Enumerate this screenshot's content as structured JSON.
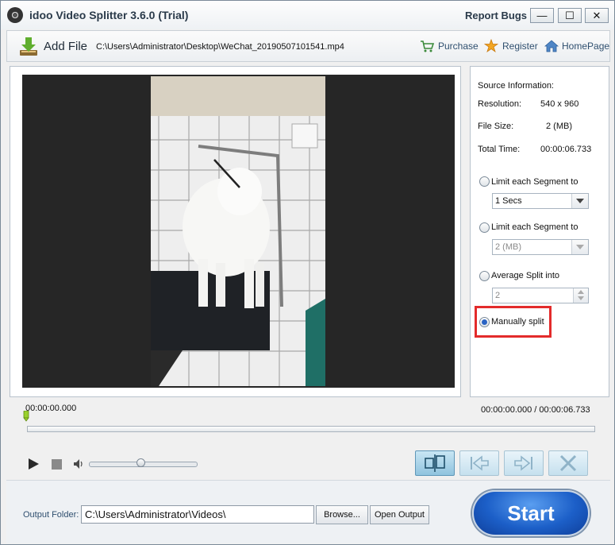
{
  "window": {
    "title": "idoo Video Splitter 3.6.0 (Trial)",
    "report_bugs": "Report Bugs",
    "minimize": "—",
    "maximize": "☐",
    "close": "✕"
  },
  "toolbar": {
    "add_file": "Add File",
    "file_path": "C:\\Users\\Administrator\\Desktop\\WeChat_20190507101541.mp4",
    "purchase": "Purchase",
    "register": "Register",
    "homepage": "HomePage"
  },
  "source_info": {
    "heading": "Source Information:",
    "resolution_label": "Resolution:",
    "resolution_value": "540 x 960",
    "filesize_label": "File Size:",
    "filesize_value": "2 (MB)",
    "totaltime_label": "Total Time:",
    "totaltime_value": "00:00:06.733"
  },
  "split_options": {
    "limit_time_label": "Limit each Segment to",
    "limit_time_value": "1 Secs",
    "limit_size_label": "Limit each Segment to",
    "limit_size_value": "2 (MB)",
    "average_label": "Average Split into",
    "average_value": "2",
    "manual_label": "Manually split",
    "selected": "manual"
  },
  "timeline": {
    "current_marker": "00:00:00.000",
    "position_display": "00:00:00.000 / 00:00:06.733",
    "playhead_fraction": 0,
    "volume_fraction": 0.48
  },
  "output": {
    "label": "Output Folder:",
    "path": "C:\\Users\\Administrator\\Videos\\",
    "browse": "Browse...",
    "open_output": "Open Output"
  },
  "start_button": "Start",
  "colors": {
    "accent_blue": "#1c5fc8",
    "highlight_red": "#e32b2b",
    "link_text": "#2f4f6f"
  }
}
